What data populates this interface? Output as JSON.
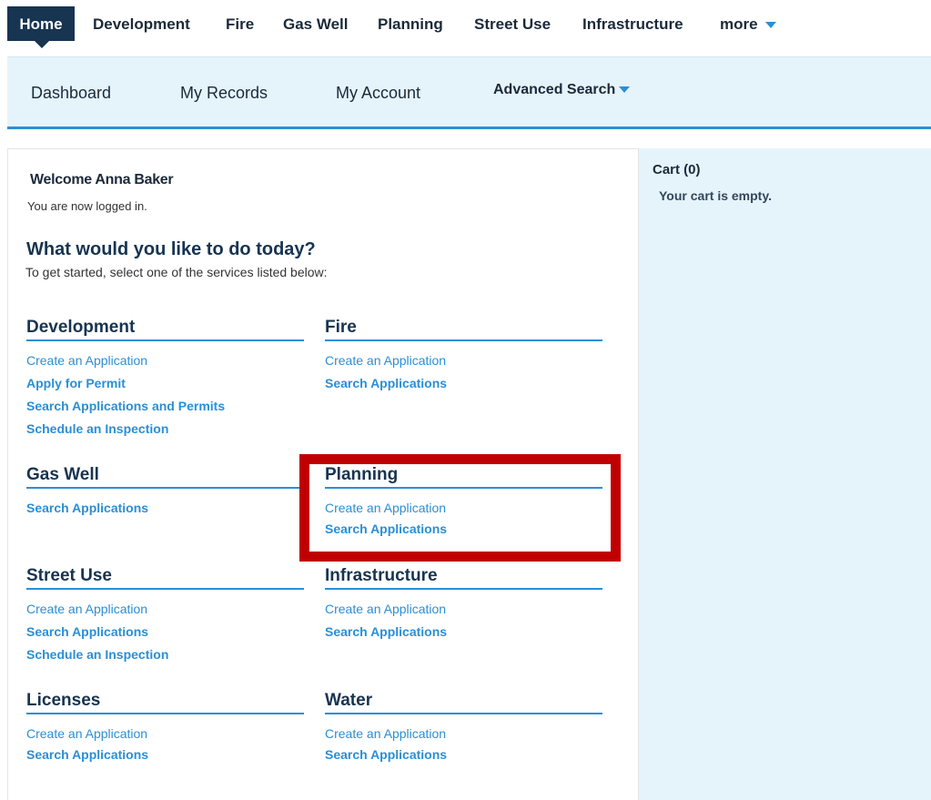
{
  "topnav": {
    "items": [
      "Home",
      "Development",
      "Fire",
      "Gas Well",
      "Planning",
      "Street Use",
      "Infrastructure",
      "more"
    ]
  },
  "subnav": {
    "items": [
      "Dashboard",
      "My Records",
      "My Account",
      "Advanced Search"
    ]
  },
  "welcome": {
    "title": "Welcome Anna Baker",
    "status": "You are now logged in."
  },
  "intro": {
    "question": "What would you like to do today?",
    "instructions": "To get started, select one of the services listed below:"
  },
  "cart": {
    "title": "Cart (0)",
    "empty_text": "Your cart is empty."
  },
  "sections": {
    "development": {
      "title": "Development",
      "links": [
        "Create an Application",
        "Apply for Permit",
        "Search Applications and Permits",
        "Schedule an Inspection"
      ]
    },
    "fire": {
      "title": "Fire",
      "links": [
        "Create an Application",
        "Search Applications"
      ]
    },
    "gaswell": {
      "title": "Gas Well",
      "links": [
        "Search Applications"
      ]
    },
    "planning": {
      "title": "Planning",
      "links": [
        "Create an Application",
        "Search Applications"
      ]
    },
    "streetuse": {
      "title": "Street Use",
      "links": [
        "Create an Application",
        "Search Applications",
        "Schedule an Inspection"
      ]
    },
    "infrastructure": {
      "title": "Infrastructure",
      "links": [
        "Create an Application",
        "Search Applications"
      ]
    },
    "licenses": {
      "title": "Licenses",
      "links": [
        "Create an Application",
        "Search Applications"
      ]
    },
    "water": {
      "title": "Water",
      "links": [
        "Create an Application",
        "Search Applications"
      ]
    }
  },
  "colors": {
    "nav_active": "#173451",
    "link": "#2a8fd6",
    "subnav_bg": "#e5f3fb",
    "highlight": "#c00000"
  }
}
